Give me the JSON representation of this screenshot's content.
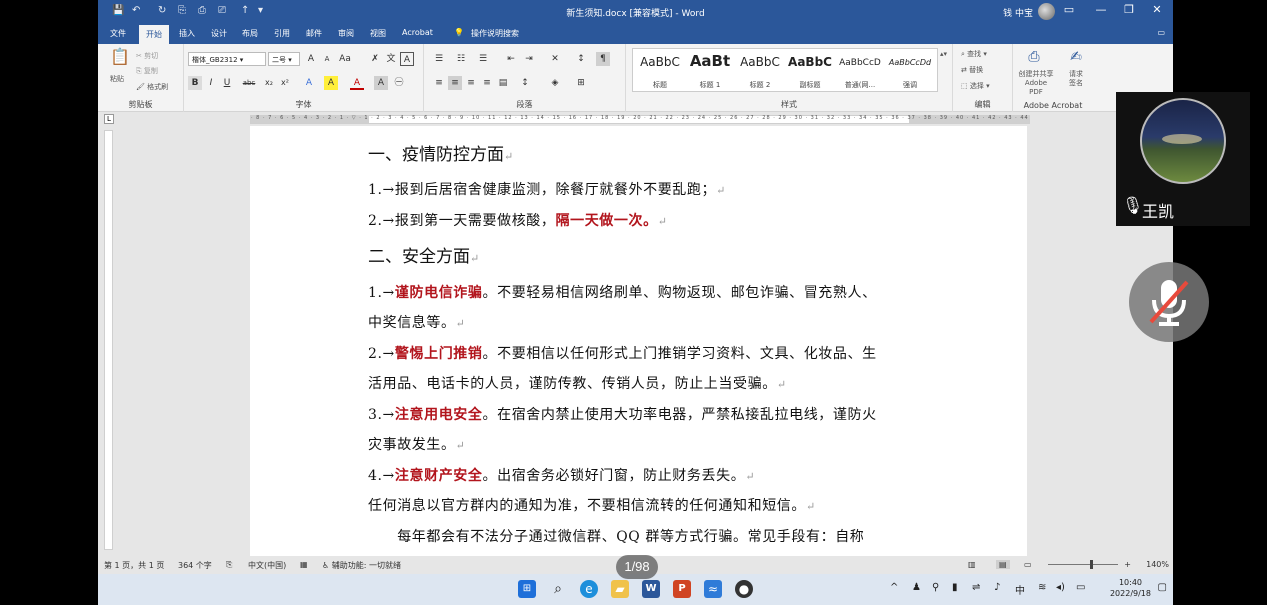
{
  "window": {
    "title": "新生须知.docx [兼容模式] - Word",
    "user_name": "钱 中宝",
    "controls": [
      "▭",
      "—",
      "❐",
      "✕"
    ]
  },
  "quick_access": [
    "💾",
    "↶",
    "↻",
    "⎘",
    "⎙",
    "⎚",
    "↑",
    "▾"
  ],
  "tabs": [
    "文件",
    "开始",
    "插入",
    "设计",
    "布局",
    "引用",
    "邮件",
    "审阅",
    "视图",
    "Acrobat",
    "操作说明搜索"
  ],
  "active_tab": "开始",
  "ribbon": {
    "clipboard": {
      "paste": "粘贴",
      "cut": "剪切",
      "copy": "复制",
      "format_painter": "格式刷",
      "label": "剪贴板"
    },
    "font": {
      "family": "楷体_GB2312",
      "size": "二号",
      "label": "字体",
      "buttons": [
        "B",
        "I",
        "U",
        "abc",
        "x₂",
        "x²",
        "A",
        "A",
        "A",
        "A"
      ]
    },
    "paragraph": {
      "label": "段落"
    },
    "styles": {
      "label": "样式",
      "items": [
        {
          "sample": "AaBbC",
          "name": "标题"
        },
        {
          "sample": "AaBt",
          "name": "标题 1"
        },
        {
          "sample": "AaBbC",
          "name": "标题 2"
        },
        {
          "sample": "AaBbC",
          "name": "副标题"
        },
        {
          "sample": "AaBbCcD",
          "name": "普通(网..."
        },
        {
          "sample": "AaBbCcDd",
          "name": "强调"
        }
      ]
    },
    "editing": {
      "find": "查找",
      "replace": "替换",
      "select": "选择",
      "label": "编辑"
    },
    "acrobat": {
      "create_share": "创建并共享 Adobe PDF",
      "request_sign": "请求签名",
      "label": "Adobe Acrobat"
    }
  },
  "document": {
    "lines": [
      {
        "type": "h",
        "text": "一、疫情防控方面"
      },
      {
        "type": "p",
        "num": "1.→",
        "red": "",
        "text": "报到后居宿舍健康监测，除餐厅就餐外不要乱跑；"
      },
      {
        "type": "p",
        "num": "2.→",
        "red": "",
        "text": "报到第一天需要做核酸，",
        "red_after": "隔一天做一次。"
      },
      {
        "type": "h",
        "text": "二、安全方面"
      },
      {
        "type": "p",
        "num": "1.→",
        "red": "谨防电信诈骗",
        "text": "。不要轻易相信网络刷单、购物返现、邮包诈骗、冒充熟人、"
      },
      {
        "type": "p",
        "num": "",
        "red": "",
        "text": "中奖信息等。"
      },
      {
        "type": "p",
        "num": "2.→",
        "red": "警惕上门推销",
        "text": "。不要相信以任何形式上门推销学习资料、文具、化妆品、生"
      },
      {
        "type": "p",
        "num": "",
        "red": "",
        "text": "活用品、电话卡的人员，谨防传教、传销人员，防止上当受骗。"
      },
      {
        "type": "p",
        "num": "3.→",
        "red": "注意用电安全",
        "text": "。在宿舍内禁止使用大功率电器，严禁私接乱拉电线，谨防火"
      },
      {
        "type": "p",
        "num": "",
        "red": "",
        "text": "灾事故发生。"
      },
      {
        "type": "p",
        "num": "4.→",
        "red": "注意财产安全",
        "text": "。出宿舍务必锁好门窗，防止财务丢失。"
      },
      {
        "type": "p",
        "num": "",
        "red": "",
        "text": "任何消息以官方群内的通知为准，不要相信流转的任何通知和短信。"
      },
      {
        "type": "p",
        "num": "",
        "red": "",
        "text": "　　每年都会有不法分子通过微信群、QQ 群等方式行骗。常见手段有：自称"
      }
    ],
    "para_mark": "↵"
  },
  "status": {
    "page": "第 1 页，共 1 页",
    "words": "364 个字",
    "lang": "中文(中国)",
    "accessibility": "辅助功能: 一切就绪",
    "zoom": "140%",
    "zoom_fraction": 0.62
  },
  "page_counter": "1/98",
  "taskbar": {
    "time": "10:40",
    "date": "2022/9/18",
    "ime": "中"
  },
  "meeting": {
    "participant": "王凯"
  }
}
